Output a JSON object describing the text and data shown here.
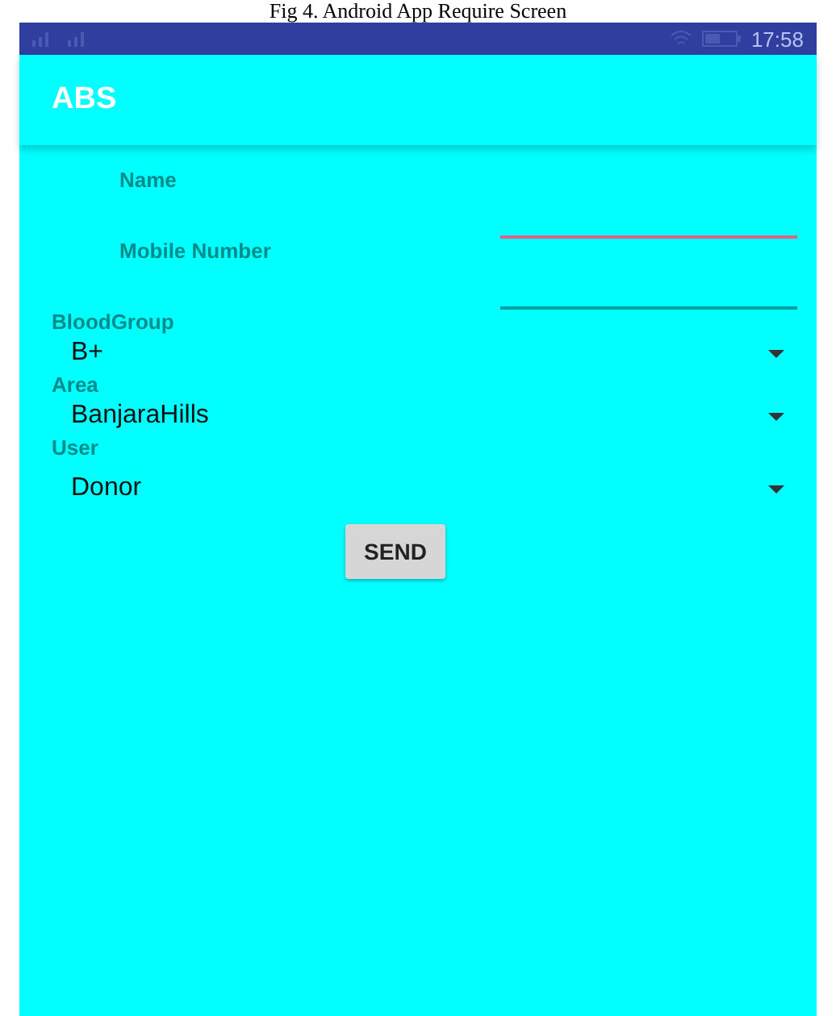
{
  "caption": "Fig 4. Android App Require Screen",
  "status_bar": {
    "time": "17:58"
  },
  "app_bar": {
    "title": "ABS"
  },
  "fields": [
    {
      "label": "Name",
      "focused": true
    },
    {
      "label": "Mobile Number",
      "focused": false
    }
  ],
  "dropdowns": [
    {
      "label": "BloodGroup",
      "value": "B+"
    },
    {
      "label": "Area",
      "value": "BanjaraHills"
    },
    {
      "label": "User",
      "value": "Donor"
    }
  ],
  "button": "SEND"
}
